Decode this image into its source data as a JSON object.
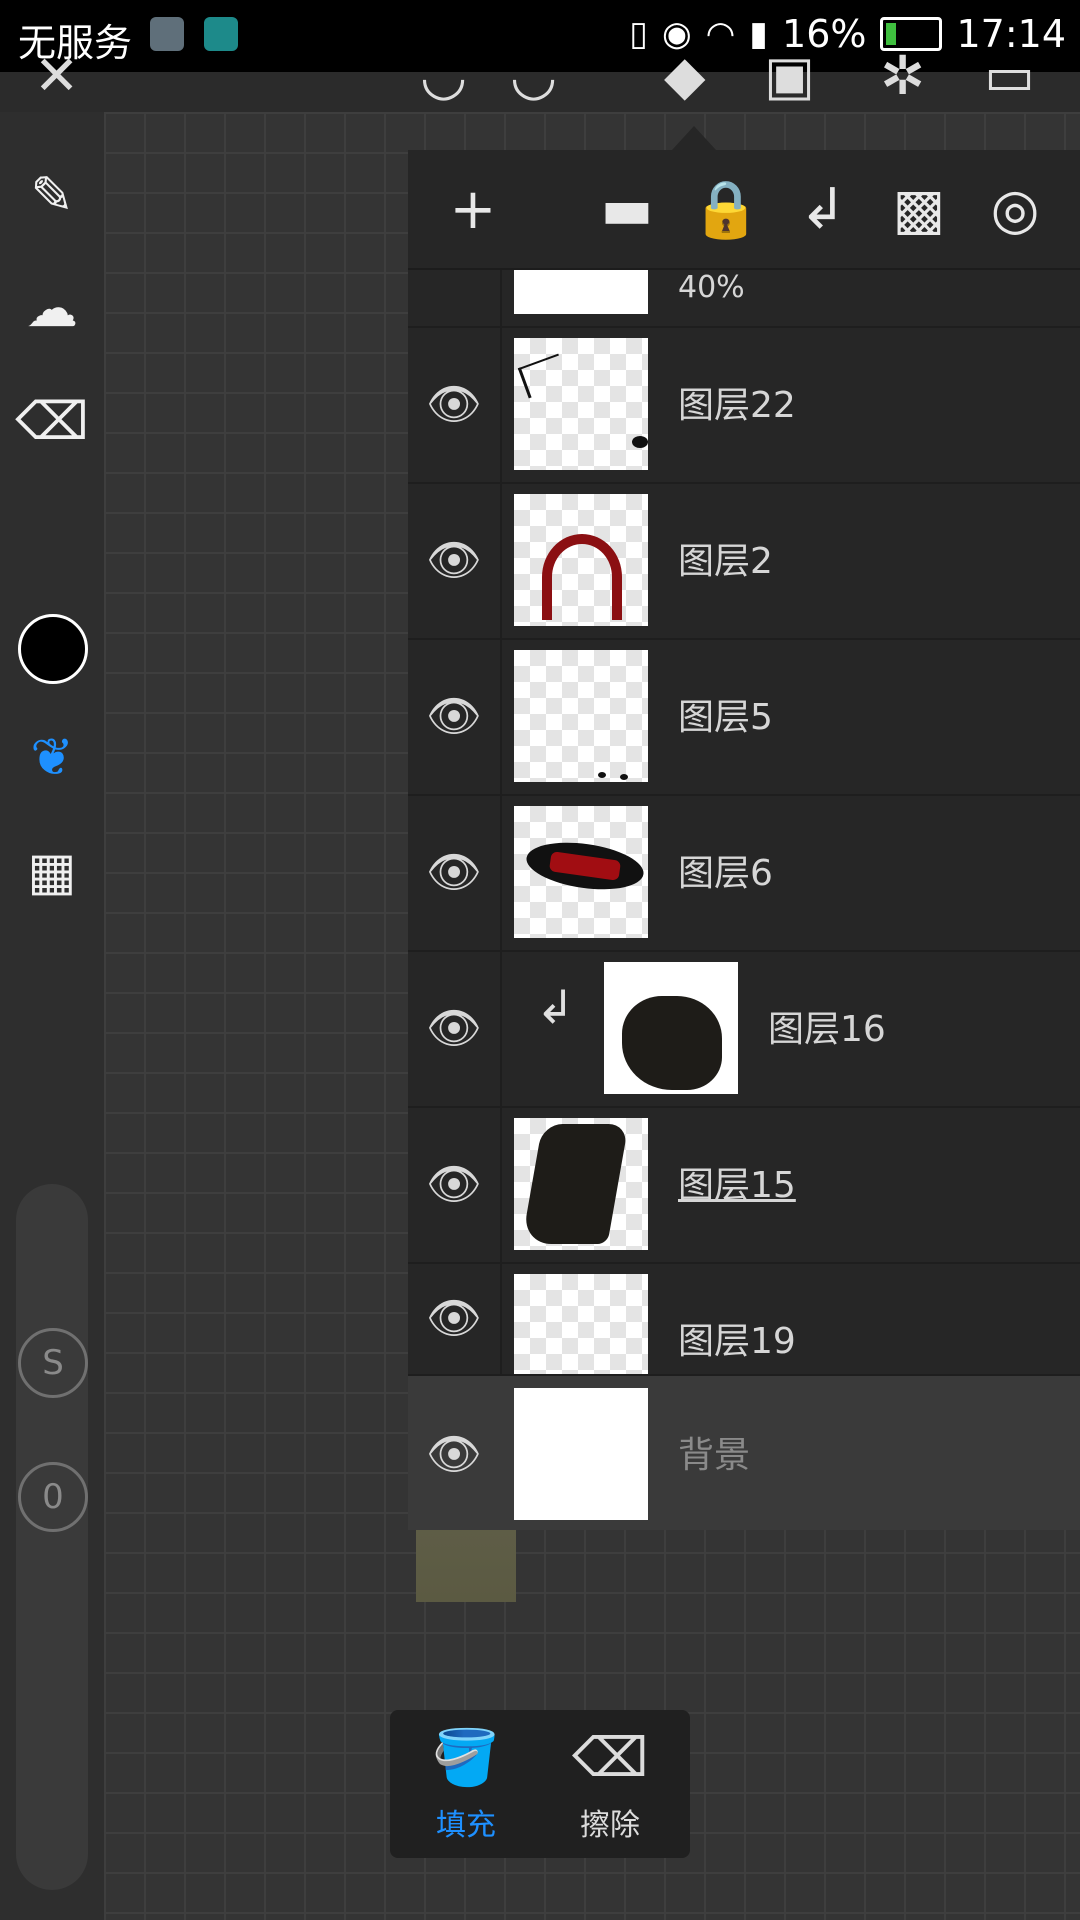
{
  "status_bar": {
    "carrier": "无服务",
    "battery": "16%",
    "time": "17:14"
  },
  "layers_panel": {
    "toolbar_icons": [
      "add-icon",
      "folder-icon",
      "lock-icon",
      "clip-arrow-icon",
      "transparency-icon",
      "target-icon"
    ],
    "partial_top_label": "40%",
    "layers": [
      {
        "name": "图层22",
        "visible": true
      },
      {
        "name": "图层2",
        "visible": true
      },
      {
        "name": "图层5",
        "visible": true
      },
      {
        "name": "图层6",
        "visible": true
      },
      {
        "name": "图层16",
        "visible": true,
        "clipped": true
      },
      {
        "name": "图层15",
        "visible": true
      },
      {
        "name": "图层19",
        "visible": true
      },
      {
        "name": "背景",
        "visible": true,
        "selected": true
      }
    ]
  },
  "fill_tools": {
    "fill_label": "填充",
    "erase_label": "擦除",
    "active": "fill"
  },
  "left_toolbar": {
    "current_color": "#000000",
    "size_badge": "S",
    "opacity_badge": "0"
  },
  "colors": {
    "accent": "#1e90ff",
    "panel": "#262626",
    "background": "#2f2f2f"
  }
}
